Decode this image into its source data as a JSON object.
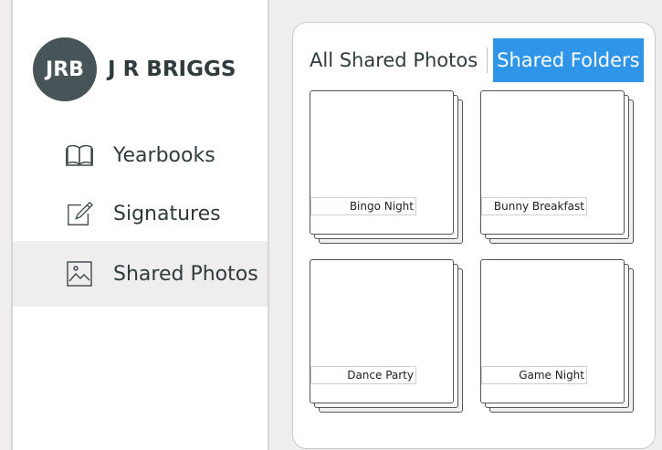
{
  "profile": {
    "initials": "JRB",
    "name": "J R BRIGGS"
  },
  "sidebar": {
    "items": [
      {
        "label": "Yearbooks",
        "icon": "book-icon"
      },
      {
        "label": "Signatures",
        "icon": "pen-icon"
      },
      {
        "label": "Shared Photos",
        "icon": "image-icon",
        "active": true
      }
    ]
  },
  "main": {
    "tabs": [
      {
        "label": "All Shared Photos",
        "active": false
      },
      {
        "label": "Shared Folders",
        "active": true
      }
    ],
    "folders": [
      {
        "name": "Bingo Night"
      },
      {
        "name": "Bunny Breakfast"
      },
      {
        "name": "Dance Party"
      },
      {
        "name": "Game Night"
      }
    ]
  },
  "colors": {
    "accent": "#2f95e8",
    "avatar": "#485558",
    "background": "#efeded"
  }
}
